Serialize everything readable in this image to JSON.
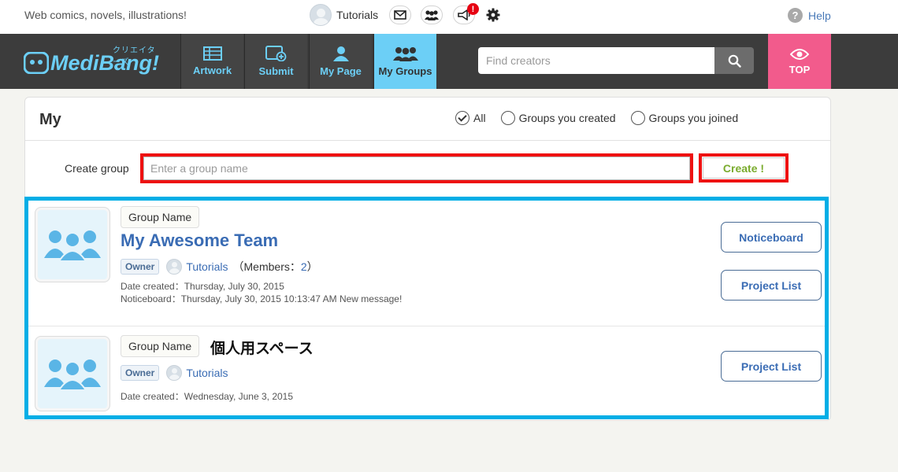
{
  "header": {
    "tagline": "Web comics, novels, illustrations!",
    "user_name": "Tutorials",
    "notification_badge": "!",
    "help_label": "Help"
  },
  "nav": {
    "logo_text": "MediBang!",
    "logo_kana": "クリエイターズ",
    "items": [
      {
        "label": "Artwork",
        "icon": "artwork-icon"
      },
      {
        "label": "Submit",
        "icon": "submit-icon"
      },
      {
        "label": "My Page",
        "icon": "user-icon"
      },
      {
        "label": "My Groups",
        "icon": "groups-icon",
        "active": true
      }
    ],
    "search_placeholder": "Find creators",
    "top_label": "TOP"
  },
  "panel": {
    "title": "My",
    "filters": [
      {
        "label": "All",
        "checked": true
      },
      {
        "label": "Groups you created",
        "checked": false
      },
      {
        "label": "Groups you joined",
        "checked": false
      }
    ],
    "create_label": "Create group",
    "create_placeholder": "Enter a group name",
    "create_button": "Create !"
  },
  "groups": [
    {
      "tag": "Group Name",
      "name": "My Awesome Team",
      "owner_tag": "Owner",
      "owner": "Tutorials",
      "members_prefix": "（Members：",
      "members_count": "2",
      "members_suffix": "）",
      "date_created": "Date created：Thursday, July 30, 2015",
      "noticeboard": "Noticeboard：Thursday, July 30, 2015 10:13:47 AM New message!",
      "buttons": [
        "Noticeboard",
        "Project List"
      ]
    },
    {
      "tag": "Group Name",
      "name": "個人用スペース",
      "owner_tag": "Owner",
      "owner": "Tutorials",
      "date_created": "Date created：Wednesday, June 3, 2015",
      "buttons": [
        "Project List"
      ]
    }
  ],
  "colors": {
    "accent": "#6ccff6",
    "link": "#3a6cb4",
    "top_button": "#f25b8c",
    "highlight_red": "#ee1111",
    "highlight_blue": "#00aee6",
    "create_green": "#7aab2d"
  }
}
